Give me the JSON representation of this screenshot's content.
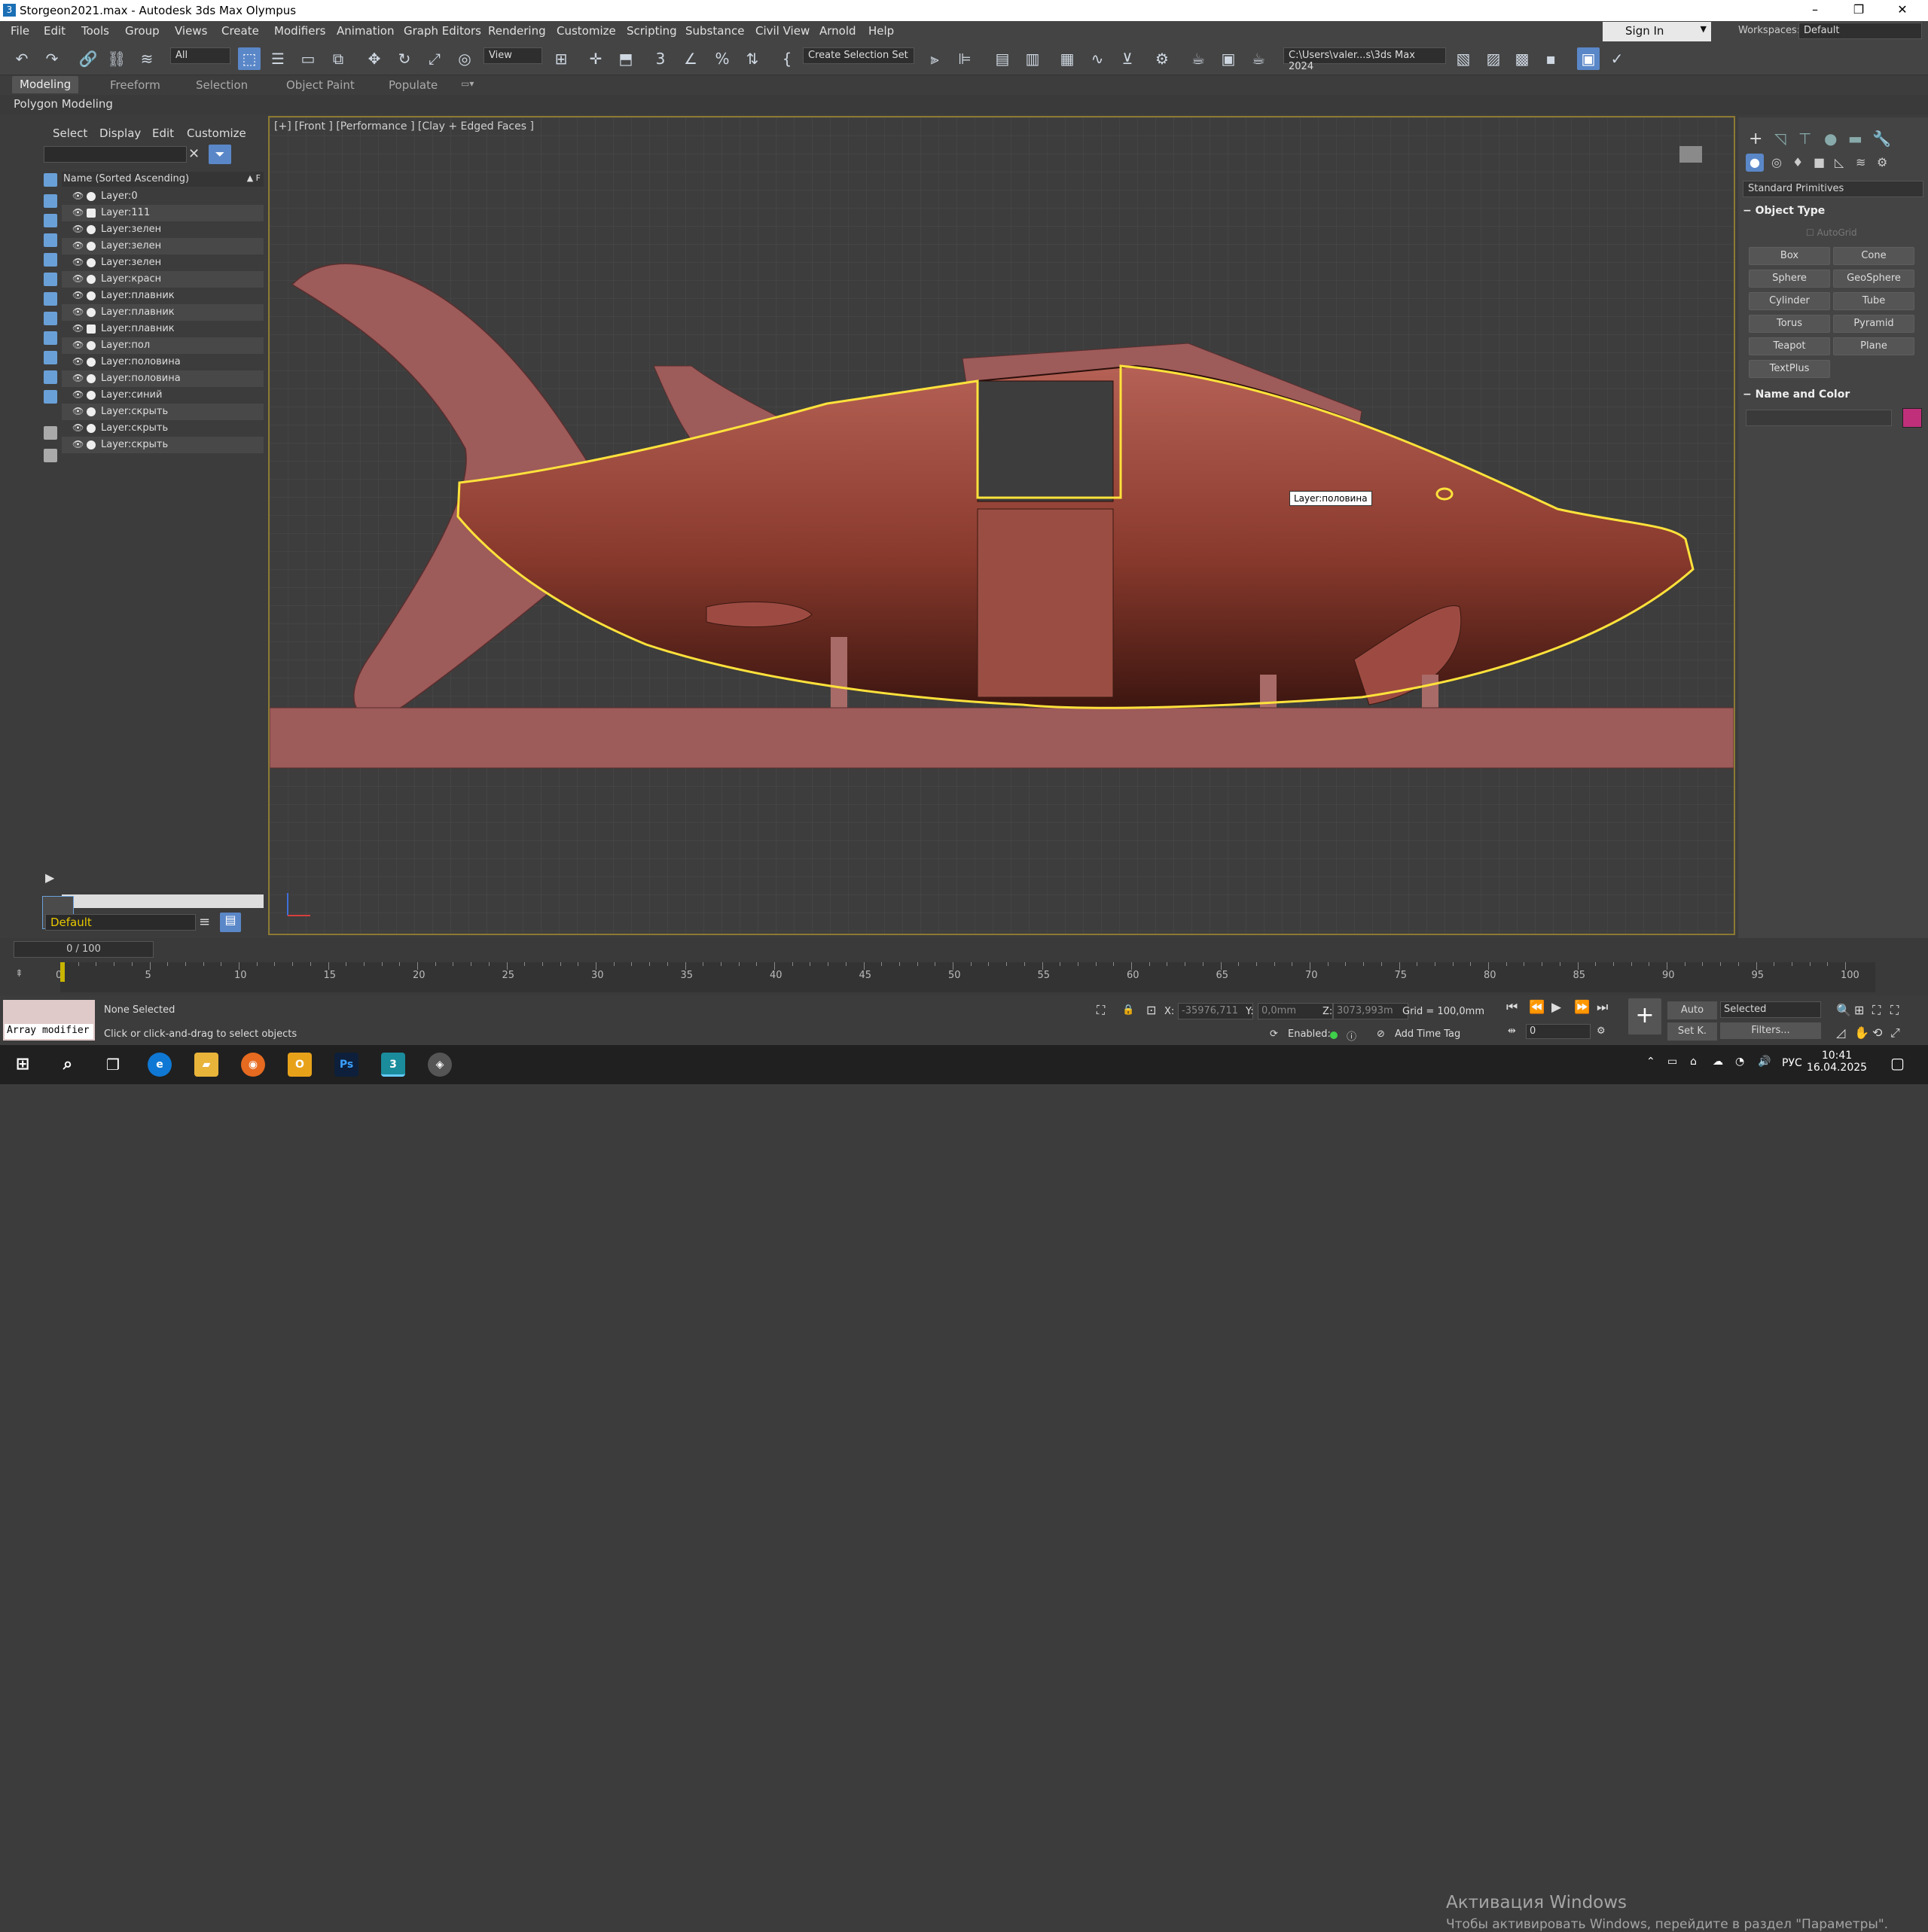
{
  "window": {
    "title": "Storgeon2021.max - Autodesk 3ds Max Olympus",
    "controls": [
      "–",
      "❐",
      "✕"
    ]
  },
  "menu": [
    "File",
    "Edit",
    "Tools",
    "Group",
    "Views",
    "Create",
    "Modifiers",
    "Animation",
    "Graph Editors",
    "Rendering",
    "Customize",
    "Scripting",
    "Substance",
    "Civil View",
    "Arnold",
    "Help"
  ],
  "signin": {
    "label": "Sign In"
  },
  "workspaces": {
    "label": "Workspaces:",
    "value": "Default"
  },
  "toolbar": {
    "filter_value": "All",
    "refcoord_value": "View",
    "selection_set_value": "Create Selection Set",
    "project_path": "C:\\Users\\valer...s\\3ds Max 2024"
  },
  "ribbon": {
    "tabs": [
      "Modeling",
      "Freeform",
      "Selection",
      "Object Paint",
      "Populate"
    ],
    "active": "Modeling",
    "sub_label": "Polygon Modeling"
  },
  "explorer": {
    "menu": [
      "Select",
      "Display",
      "Edit",
      "Customize"
    ],
    "header": "Name (Sorted Ascending)",
    "header_flag": "▲ F",
    "layers": [
      "Layer:0",
      "Layer:111",
      "Layer:зелен",
      "Layer:зелен",
      "Layer:зелен",
      "Layer:красн",
      "Layer:плавник",
      "Layer:плавник",
      "Layer:плавник",
      "Layer:пол",
      "Layer:половина",
      "Layer:половина",
      "Layer:синий",
      "Layer:скрыть",
      "Layer:скрыть",
      "Layer:скрыть"
    ],
    "current_layer": "Default"
  },
  "viewport": {
    "label": "[+] [Front ] [Performance ] [Clay + Edged Faces ]",
    "tooltip": "Layer:половина"
  },
  "command_panel": {
    "category": "Standard Primitives",
    "object_type_title": "Object Type",
    "autogrid": "AutoGrid",
    "buttons": [
      "Box",
      "Cone",
      "Sphere",
      "GeoSphere",
      "Cylinder",
      "Tube",
      "Torus",
      "Pyramid",
      "Teapot",
      "Plane",
      "TextPlus"
    ],
    "name_color_title": "Name and Color",
    "color_swatch": "#c0307a"
  },
  "timeline": {
    "frame": "0 / 100",
    "ticks": [
      0,
      5,
      10,
      15,
      20,
      25,
      30,
      35,
      40,
      45,
      50,
      55,
      60,
      65,
      70,
      75,
      80,
      85,
      90,
      95,
      100
    ]
  },
  "status": {
    "maxscript_label": "Array modifier",
    "selected_text": "None Selected",
    "prompt": "Click or click-and-drag to select objects",
    "x_label": "X:",
    "x_value": "-35976,711",
    "y_label": "Y:",
    "y_value": "0,0mm",
    "z_label": "Z:",
    "z_value": "3073,993m",
    "grid": "Grid = 100,0mm",
    "enabled_label": "Enabled:",
    "add_time_tag": "Add Time Tag",
    "auto_label": "Auto",
    "setk_label": "Set K.",
    "selected_set": "Selected",
    "filters_label": "Filters...",
    "frame_spinner": "0"
  },
  "activation": {
    "line1": "Активация Windows",
    "line2": "Чтобы активировать Windows, перейдите в раздел \"Параметры\"."
  },
  "taskbar": {
    "lang": "РУС",
    "time": "10:41",
    "date": "16.04.2025"
  }
}
